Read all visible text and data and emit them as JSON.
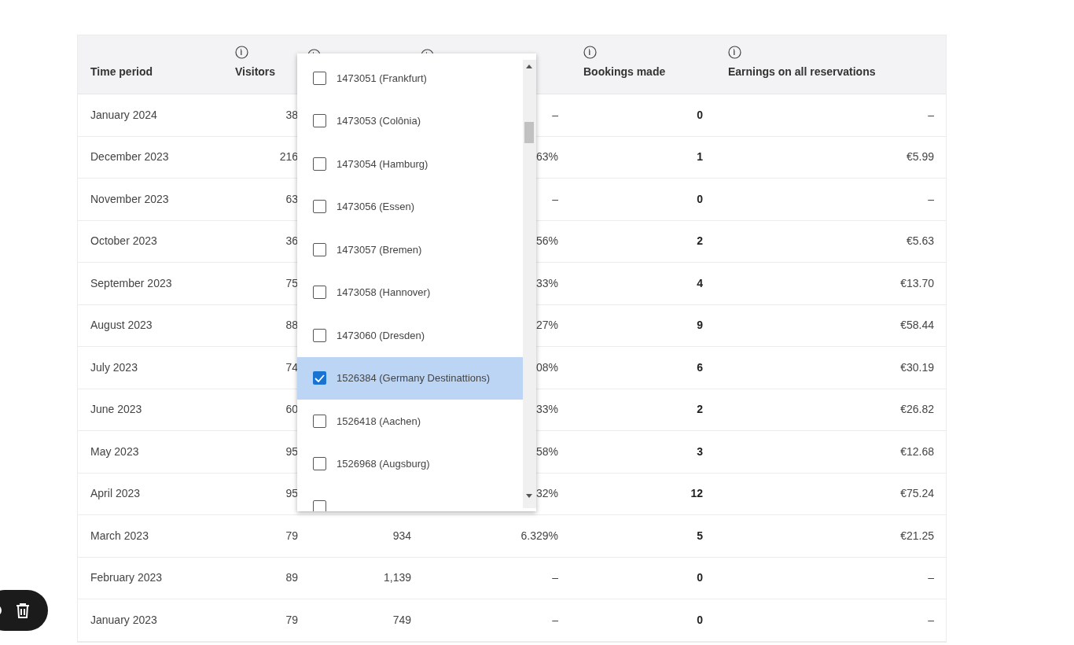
{
  "table": {
    "columns": [
      {
        "label": "Time period",
        "info": false
      },
      {
        "label": "Visitors",
        "info": true
      },
      {
        "info": true
      },
      {
        "info": true
      },
      {
        "label": "Bookings made",
        "info": true
      },
      {
        "label": "Earnings on all reservations",
        "info": true
      }
    ],
    "rows": [
      {
        "cells": [
          "January 2024",
          "38",
          "",
          "–",
          "0",
          "–"
        ]
      },
      {
        "cells": [
          "December 2023",
          "216",
          "",
          "63%",
          "1",
          "€5.99"
        ]
      },
      {
        "cells": [
          "November 2023",
          "63",
          "",
          "–",
          "0",
          "–"
        ]
      },
      {
        "cells": [
          "October 2023",
          "36",
          "",
          "56%",
          "2",
          "€5.63"
        ]
      },
      {
        "cells": [
          "September 2023",
          "75",
          "",
          "33%",
          "4",
          "€13.70"
        ]
      },
      {
        "cells": [
          "August 2023",
          "88",
          "",
          "27%",
          "9",
          "€58.44"
        ]
      },
      {
        "cells": [
          "July 2023",
          "74",
          "",
          "08%",
          "6",
          "€30.19"
        ]
      },
      {
        "cells": [
          "June 2023",
          "60",
          "",
          "33%",
          "2",
          "€26.82"
        ]
      },
      {
        "cells": [
          "May 2023",
          "95",
          "",
          "58%",
          "3",
          "€12.68"
        ]
      },
      {
        "cells": [
          "April 2023",
          "95",
          "",
          "32%",
          "12",
          "€75.24"
        ]
      },
      {
        "cells": [
          "March 2023",
          "79",
          "934",
          "6.329%",
          "5",
          "€21.25"
        ]
      },
      {
        "cells": [
          "February 2023",
          "89",
          "1,139",
          "–",
          "0",
          "–"
        ]
      },
      {
        "cells": [
          "January 2023",
          "79",
          "749",
          "–",
          "0",
          "–"
        ]
      }
    ]
  },
  "dropdown": {
    "options": [
      {
        "label": "1473051 (Frankfurt)",
        "checked": false
      },
      {
        "label": "1473053 (Colônia)",
        "checked": false
      },
      {
        "label": "1473054 (Hamburg)",
        "checked": false
      },
      {
        "label": "1473056 (Essen)",
        "checked": false
      },
      {
        "label": "1473057 (Bremen)",
        "checked": false
      },
      {
        "label": "1473058 (Hannover)",
        "checked": false
      },
      {
        "label": "1473060 (Dresden)",
        "checked": false
      },
      {
        "label": "1526384 (Germany Destinattions)",
        "checked": true
      },
      {
        "label": "1526418 (Aachen)",
        "checked": false
      },
      {
        "label": "1526968 (Augsburg)",
        "checked": false
      },
      {
        "checked": false
      }
    ]
  }
}
